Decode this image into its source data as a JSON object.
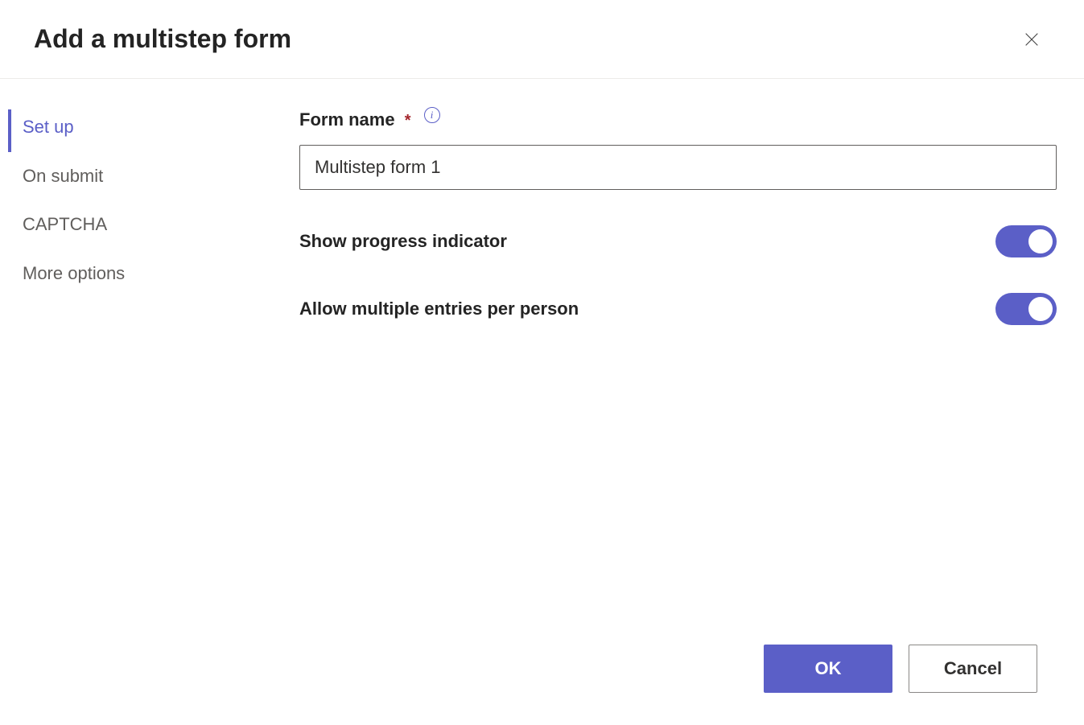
{
  "dialog": {
    "title": "Add a multistep form"
  },
  "sidebar": {
    "items": [
      {
        "label": "Set up",
        "active": true
      },
      {
        "label": "On submit",
        "active": false
      },
      {
        "label": "CAPTCHA",
        "active": false
      },
      {
        "label": "More options",
        "active": false
      }
    ]
  },
  "form": {
    "name_label": "Form name",
    "name_value": "Multistep form 1",
    "show_progress_label": "Show progress indicator",
    "show_progress_on": true,
    "allow_multiple_label": "Allow multiple entries per person",
    "allow_multiple_on": true
  },
  "footer": {
    "ok_label": "OK",
    "cancel_label": "Cancel"
  }
}
